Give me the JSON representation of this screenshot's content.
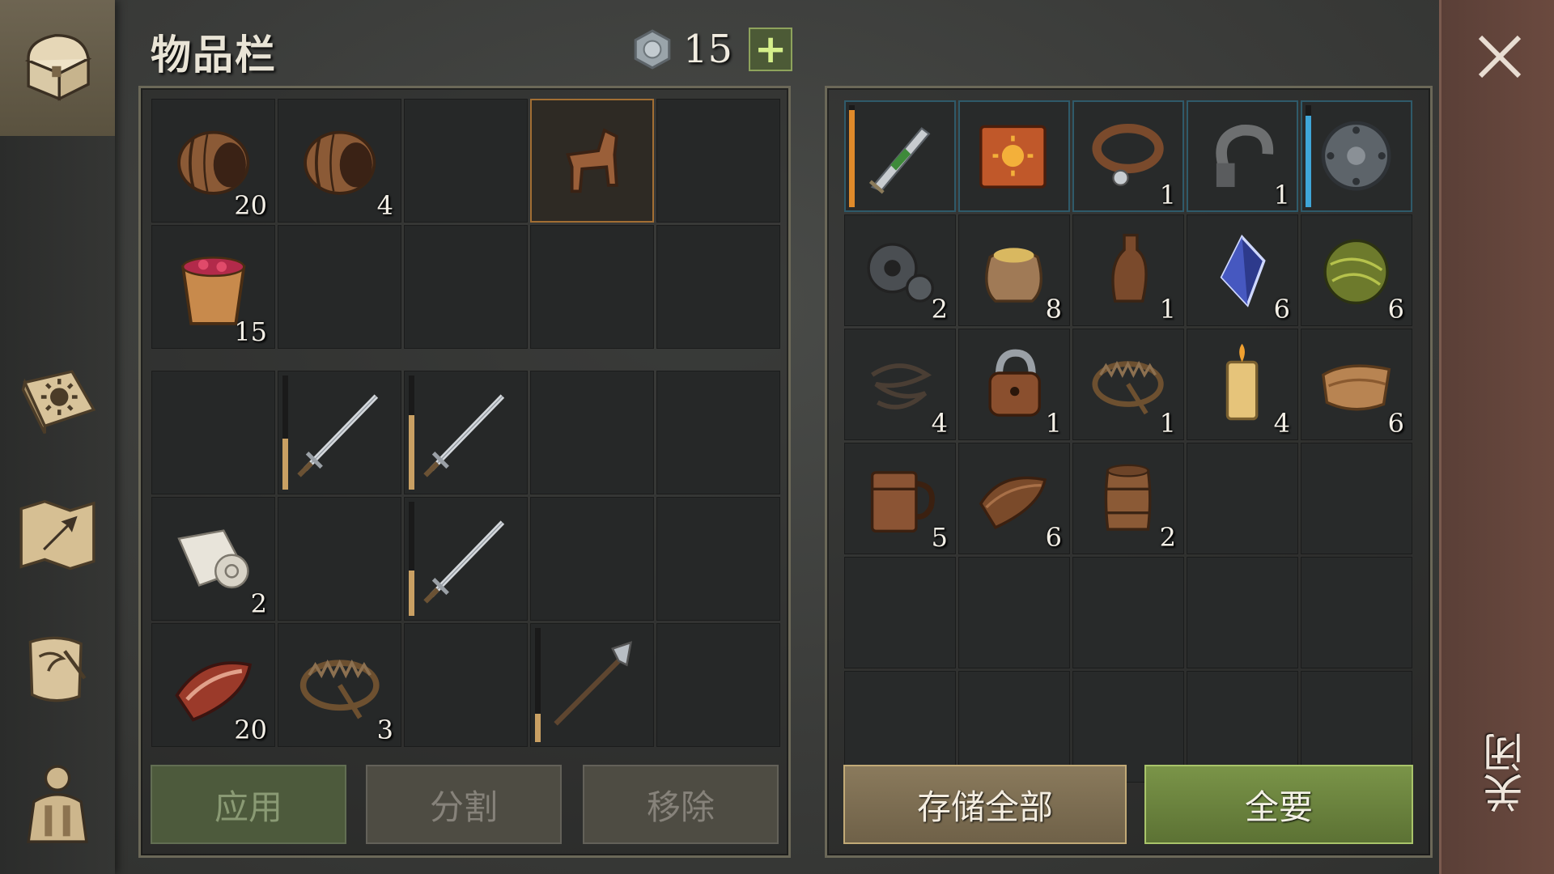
{
  "header": {
    "title": "物品栏",
    "currency_count": "15",
    "add_label": "+"
  },
  "left_inventory": {
    "top_grid": [
      {
        "icon": "barrel-icon",
        "count": "20"
      },
      {
        "icon": "barrel-icon",
        "count": "4"
      },
      {
        "icon": "",
        "count": ""
      },
      {
        "icon": "wooden-horse-icon",
        "count": "",
        "highlight": true
      },
      {
        "icon": "",
        "count": ""
      },
      {
        "icon": "berry-bucket-icon",
        "count": "15"
      },
      {
        "icon": "",
        "count": ""
      },
      {
        "icon": "",
        "count": ""
      },
      {
        "icon": "",
        "count": ""
      },
      {
        "icon": "",
        "count": ""
      }
    ],
    "bottom_grid": [
      {
        "icon": "",
        "count": ""
      },
      {
        "icon": "sword-icon",
        "count": "",
        "durability": 0.45,
        "bar_color": "#c9a063"
      },
      {
        "icon": "sword-icon",
        "count": "",
        "durability": 0.65,
        "bar_color": "#c9a063"
      },
      {
        "icon": "",
        "count": ""
      },
      {
        "icon": "",
        "count": ""
      },
      {
        "icon": "cloth-roll-icon",
        "count": "2"
      },
      {
        "icon": "",
        "count": ""
      },
      {
        "icon": "sword-icon",
        "count": "",
        "durability": 0.4,
        "bar_color": "#c9a063"
      },
      {
        "icon": "",
        "count": ""
      },
      {
        "icon": "",
        "count": ""
      },
      {
        "icon": "meat-icon",
        "count": "20"
      },
      {
        "icon": "bear-trap-icon",
        "count": "3"
      },
      {
        "icon": "",
        "count": ""
      },
      {
        "icon": "halberd-icon",
        "count": "",
        "durability": 0.25,
        "bar_color": "#c9a063"
      },
      {
        "icon": "",
        "count": ""
      }
    ]
  },
  "storage": {
    "grid": [
      {
        "icon": "green-dagger-icon",
        "count": "",
        "equip": true,
        "durability": 0.95,
        "bar_color": "#e08a2a"
      },
      {
        "icon": "sun-book-icon",
        "count": "",
        "equip": true
      },
      {
        "icon": "collar-icon",
        "count": "1",
        "equip": true
      },
      {
        "icon": "shackle-icon",
        "count": "1",
        "equip": true
      },
      {
        "icon": "round-shield-icon",
        "count": "",
        "equip": true,
        "durability": 0.9,
        "bar_color": "#3fa6d8"
      },
      {
        "icon": "gear-icon",
        "count": "2"
      },
      {
        "icon": "grain-sack-icon",
        "count": "8"
      },
      {
        "icon": "bottle-icon",
        "count": "1"
      },
      {
        "icon": "crystal-icon",
        "count": "6"
      },
      {
        "icon": "fiber-ball-icon",
        "count": "6"
      },
      {
        "icon": "rope-icon",
        "count": "4"
      },
      {
        "icon": "padlock-icon",
        "count": "1"
      },
      {
        "icon": "bear-trap-icon",
        "count": "1"
      },
      {
        "icon": "candle-icon",
        "count": "4"
      },
      {
        "icon": "leather-icon",
        "count": "6"
      },
      {
        "icon": "mug-icon",
        "count": "5"
      },
      {
        "icon": "scroll-leather-icon",
        "count": "6"
      },
      {
        "icon": "small-barrel-icon",
        "count": "2"
      },
      {
        "icon": "",
        "count": ""
      },
      {
        "icon": "",
        "count": ""
      },
      {
        "icon": "",
        "count": ""
      },
      {
        "icon": "",
        "count": ""
      },
      {
        "icon": "",
        "count": ""
      },
      {
        "icon": "",
        "count": ""
      },
      {
        "icon": "",
        "count": ""
      },
      {
        "icon": "",
        "count": ""
      },
      {
        "icon": "",
        "count": ""
      },
      {
        "icon": "",
        "count": ""
      },
      {
        "icon": "",
        "count": ""
      },
      {
        "icon": "",
        "count": ""
      }
    ]
  },
  "buttons": {
    "apply": "应用",
    "split": "分割",
    "remove": "移除",
    "store_all": "存储全部",
    "take_all": "全要"
  },
  "close": {
    "label": "关闭"
  },
  "sidebar": {
    "items": [
      {
        "icon": "chest-icon",
        "active": true
      },
      {
        "icon": "sun-book-icon"
      },
      {
        "icon": "map-arrow-icon"
      },
      {
        "icon": "quest-scroll-icon"
      },
      {
        "icon": "character-icon"
      }
    ]
  },
  "colors": {
    "accent_green": "#5c7234",
    "accent_gold": "#c2aa77",
    "close_bg": "#6b4a3f",
    "highlight": "#a26e33",
    "equip_border": "#2f5a6a"
  }
}
